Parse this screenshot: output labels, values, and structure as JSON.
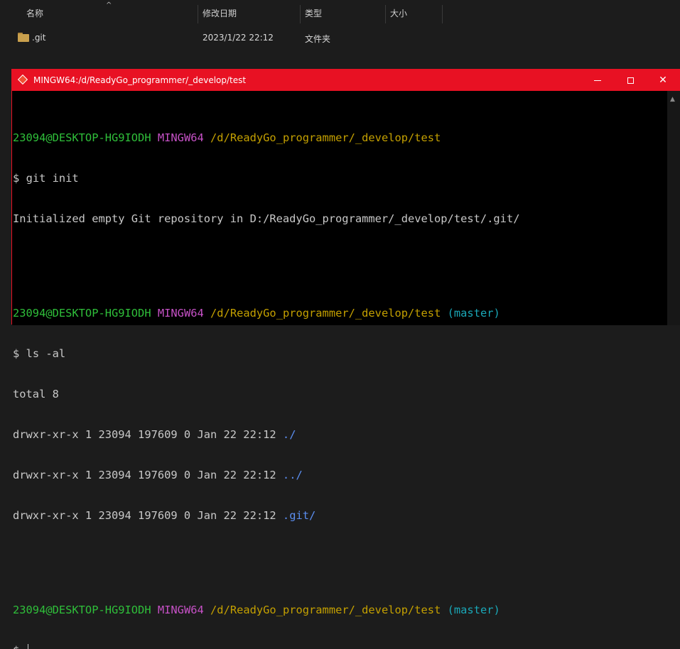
{
  "explorer": {
    "columns": {
      "name": "名称",
      "modified": "修改日期",
      "type": "类型",
      "size": "大小"
    },
    "sort_indicator": "^",
    "files": [
      {
        "name": ".git",
        "modified": "2023/1/22 22:12",
        "type": "文件夹",
        "size": "",
        "icon": "folder-icon"
      }
    ]
  },
  "terminal": {
    "title": "MINGW64:/d/ReadyGo_programmer/_develop/test",
    "controls": {
      "minimize": "—",
      "maximize": "☐",
      "close": "✕"
    },
    "prompt_user": "23094@DESKTOP-HG9IODH",
    "prompt_env": "MINGW64",
    "prompt_path": "/d/ReadyGo_programmer/_develop/test",
    "prompt_branch": "(master)",
    "prompt_symbol": "$",
    "cmd1": "git init",
    "out1": "Initialized empty Git repository in D:/ReadyGo_programmer/_develop/test/.git/",
    "cmd2": "ls -al",
    "total": "total 8",
    "ls_rows": [
      {
        "meta": "drwxr-xr-x 1 23094 197609 0 Jan 22 22:12",
        "name": "./"
      },
      {
        "meta": "drwxr-xr-x 1 23094 197609 0 Jan 22 22:12",
        "name": "../"
      },
      {
        "meta": "drwxr-xr-x 1 23094 197609 0 Jan 22 22:12",
        "name": ".git/"
      }
    ],
    "colors": {
      "titlebar": "#e81123",
      "user": "#2fbf3a",
      "env": "#c651c6",
      "path": "#c4a000",
      "branch": "#1aa8b8",
      "dir": "#5b8ef0"
    }
  }
}
